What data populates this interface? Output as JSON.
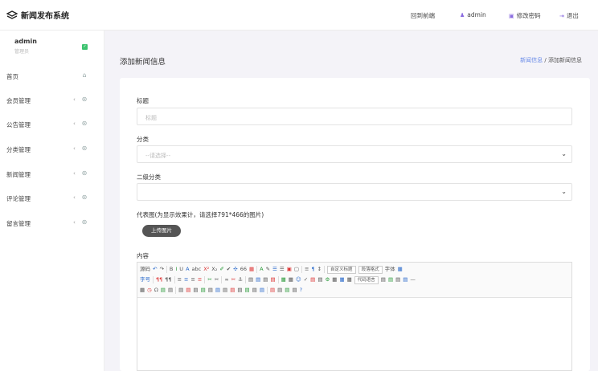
{
  "header": {
    "app_title": "新闻发布系统",
    "links": [
      {
        "label": "回到前端",
        "icon": "home-icon"
      },
      {
        "label": "admin",
        "icon": "user-icon"
      },
      {
        "label": "修改密码",
        "icon": "key-icon"
      },
      {
        "label": "退出",
        "icon": "logout-icon"
      }
    ]
  },
  "sidebar": {
    "user": {
      "name": "admin",
      "role": "管理员"
    },
    "items": [
      {
        "label": "首页",
        "icon": "home-icon",
        "has_children": false
      },
      {
        "label": "会员管理",
        "icon": "gear-icon",
        "has_children": true
      },
      {
        "label": "公告管理",
        "icon": "gear-icon",
        "has_children": true
      },
      {
        "label": "分类管理",
        "icon": "gear-icon",
        "has_children": true
      },
      {
        "label": "新闻管理",
        "icon": "gear-icon",
        "has_children": true
      },
      {
        "label": "评论管理",
        "icon": "gear-icon",
        "has_children": true
      },
      {
        "label": "留言管理",
        "icon": "gear-icon",
        "has_children": true
      }
    ]
  },
  "main": {
    "title": "添加新闻信息",
    "breadcrumb": {
      "parent": "新闻信息",
      "separator": "/",
      "current": "添加新闻信息"
    },
    "form": {
      "title_label": "标题",
      "title_placeholder": "标题",
      "category_label": "分类",
      "category_value": "--请选择--",
      "subcategory_label": "二级分类",
      "subcategory_value": "",
      "image_label": "代表图(为显示效果计，请选择791*466的图片)",
      "upload_label": "上传图片",
      "content_label": "内容"
    },
    "editor": {
      "row1": [
        "源码",
        "↶",
        "↷",
        "|",
        "B",
        "I",
        "U",
        "A",
        "abc",
        "X²",
        "X₂",
        "✐",
        "✔",
        "✣",
        "66",
        "▦",
        "|",
        "A",
        "✎",
        "☰",
        "☰",
        "▣",
        "▢",
        "|",
        "≡",
        "¶",
        "↕",
        "|",
        "自定义标题",
        "段落格式",
        "字体",
        "▦"
      ],
      "row2": [
        "字号",
        "|",
        "¶¶",
        "¶¶",
        "|",
        "≡",
        "≡",
        "≡",
        "≡",
        "|",
        "✂",
        "✂",
        "|",
        "∞",
        "✂",
        "⚓",
        "|",
        "▤",
        "▤",
        "▤",
        "▤",
        "|",
        "▦",
        "▦",
        "☺",
        "✓",
        "▤",
        "▤",
        "⚙",
        "▦",
        "▦",
        "▦",
        "代码语言",
        "▤",
        "▤",
        "▤",
        "▤",
        "—"
      ],
      "row3": [
        "▦",
        "◷",
        "Ω",
        "▤",
        "▤",
        "|",
        "▤",
        "▤",
        "▤",
        "▤",
        "▤",
        "▤",
        "▤",
        "▤",
        "▤",
        "▤",
        "▤",
        "▤",
        "|",
        "▤",
        "▤",
        "▤",
        "▤",
        "?"
      ]
    }
  }
}
